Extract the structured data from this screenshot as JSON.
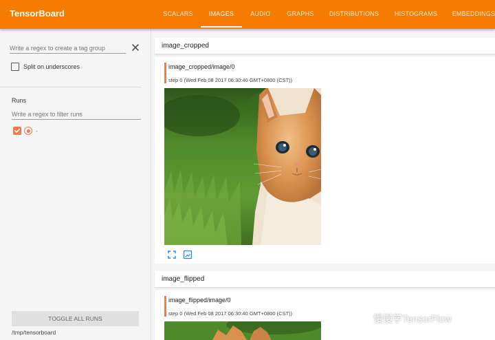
{
  "header": {
    "brand": "TensorBoard",
    "tabs": [
      {
        "label": "SCALARS"
      },
      {
        "label": "IMAGES",
        "active": true
      },
      {
        "label": "AUDIO"
      },
      {
        "label": "GRAPHS"
      },
      {
        "label": "DISTRIBUTIONS"
      },
      {
        "label": "HISTOGRAMS"
      },
      {
        "label": "EMBEDDINGS"
      }
    ]
  },
  "sidebar": {
    "tag_filter": {
      "placeholder": "Write a regex to create a tag group",
      "value": ""
    },
    "split_underscores": {
      "label": "Split on underscores",
      "checked": false
    },
    "runs": {
      "title": "Runs",
      "filter_placeholder": "Write a regex to filter runs",
      "items": [
        {
          "label": ".",
          "checked": true
        }
      ]
    },
    "toggle_label": "TOGGLE ALL RUNS",
    "logdir": "/tmp/tensorboard"
  },
  "cards": [
    {
      "title": "image_cropped",
      "image_tag": "image_cropped/image/0",
      "dot": ".",
      "step": "step 0 (Wed Feb 08 2017 06:30:40 GMT+0800 (CST))"
    },
    {
      "title": "image_flipped",
      "image_tag": "image_flipped/image/0",
      "dot": ".",
      "step": "step 0 (Wed Feb 08 2017 06:30:40 GMT+0800 (CST))"
    }
  ],
  "watermark": "慢慢学TensorFlow",
  "colors": {
    "header": "#f57c00",
    "accent": "#f4794c",
    "icon": "#1e88e5"
  },
  "icons": [
    "close-icon",
    "fullscreen-icon",
    "actual-size-icon",
    "wechat-icon"
  ]
}
